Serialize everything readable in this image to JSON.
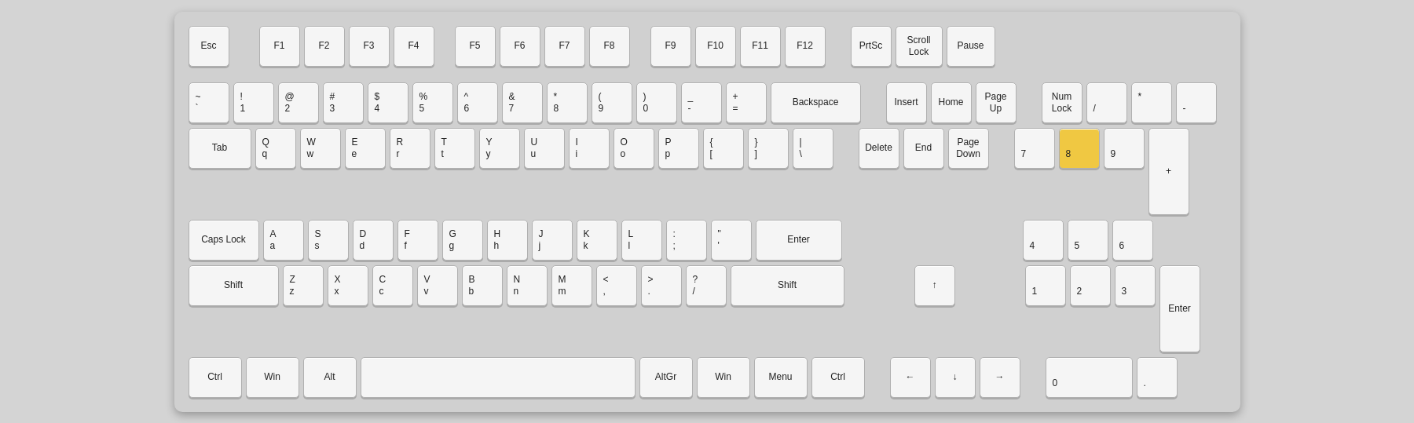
{
  "keyboard": {
    "rows": {
      "fn": {
        "keys": [
          {
            "label": "Esc",
            "id": "esc"
          },
          {
            "gap": "28"
          },
          {
            "label": "F1",
            "id": "f1"
          },
          {
            "label": "F2",
            "id": "f2"
          },
          {
            "label": "F3",
            "id": "f3"
          },
          {
            "label": "F4",
            "id": "f4"
          },
          {
            "gap": "16"
          },
          {
            "label": "F5",
            "id": "f5"
          },
          {
            "label": "F6",
            "id": "f6"
          },
          {
            "label": "F7",
            "id": "f7"
          },
          {
            "label": "F8",
            "id": "f8"
          },
          {
            "gap": "16"
          },
          {
            "label": "F9",
            "id": "f9"
          },
          {
            "label": "F10",
            "id": "f10"
          },
          {
            "label": "F11",
            "id": "f11"
          },
          {
            "label": "F12",
            "id": "f12"
          },
          {
            "gap": "22"
          },
          {
            "label": "PrtSc",
            "id": "prtsc"
          },
          {
            "label": "Scroll\nLock",
            "id": "scrolllock"
          },
          {
            "label": "Pause",
            "id": "pause"
          }
        ]
      }
    },
    "highlighted_key": "numpad-8"
  }
}
